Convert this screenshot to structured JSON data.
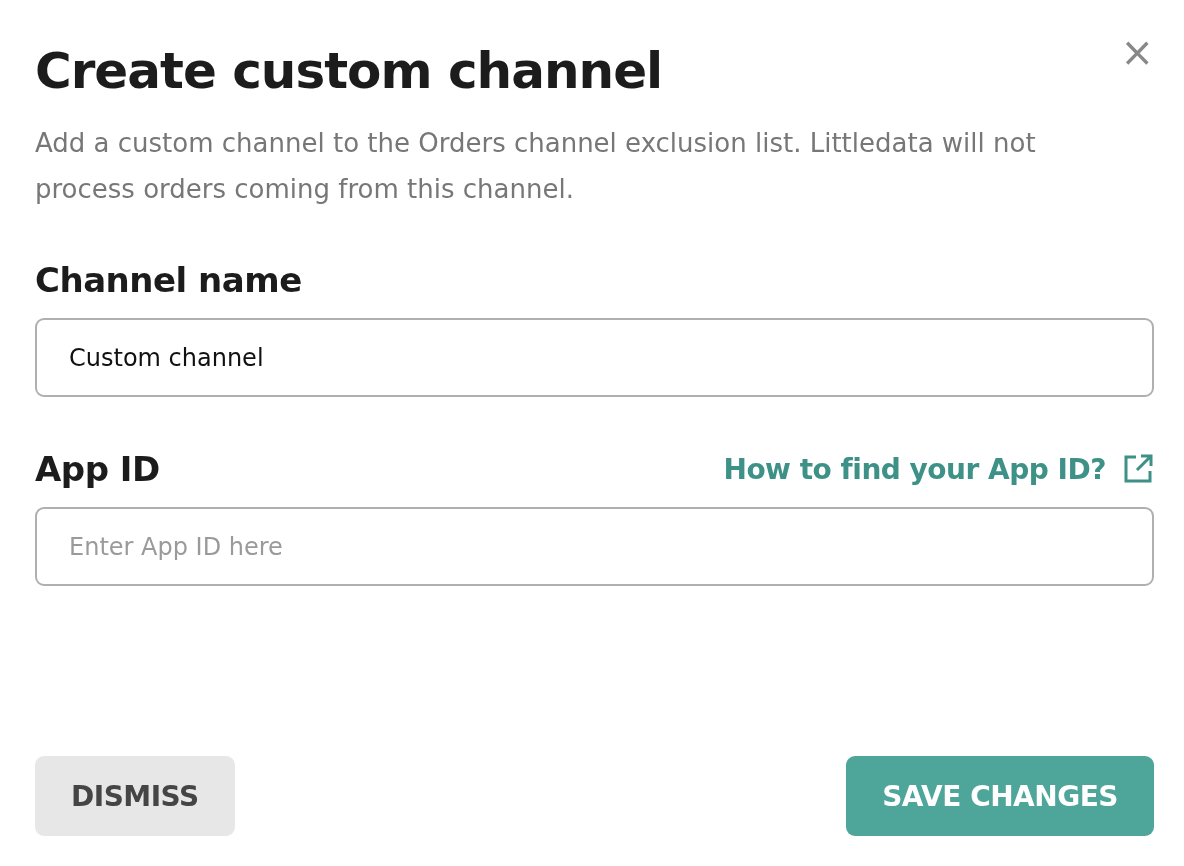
{
  "dialog": {
    "title": "Create custom channel",
    "close": "×",
    "description": "Add a custom channel to the Orders channel exclusion list. Littledata will not process orders coming from this channel."
  },
  "fields": [
    {
      "label": "Channel name",
      "value": "Custom channel"
    },
    {
      "label": "App ID",
      "placeholder": "Enter App ID here",
      "help_link": "How to find your App ID?"
    }
  ],
  "buttons": [
    {
      "label": "DISMISS",
      "kind": "secondary"
    },
    {
      "label": "SAVE CHANGES",
      "kind": "primary"
    }
  ]
}
